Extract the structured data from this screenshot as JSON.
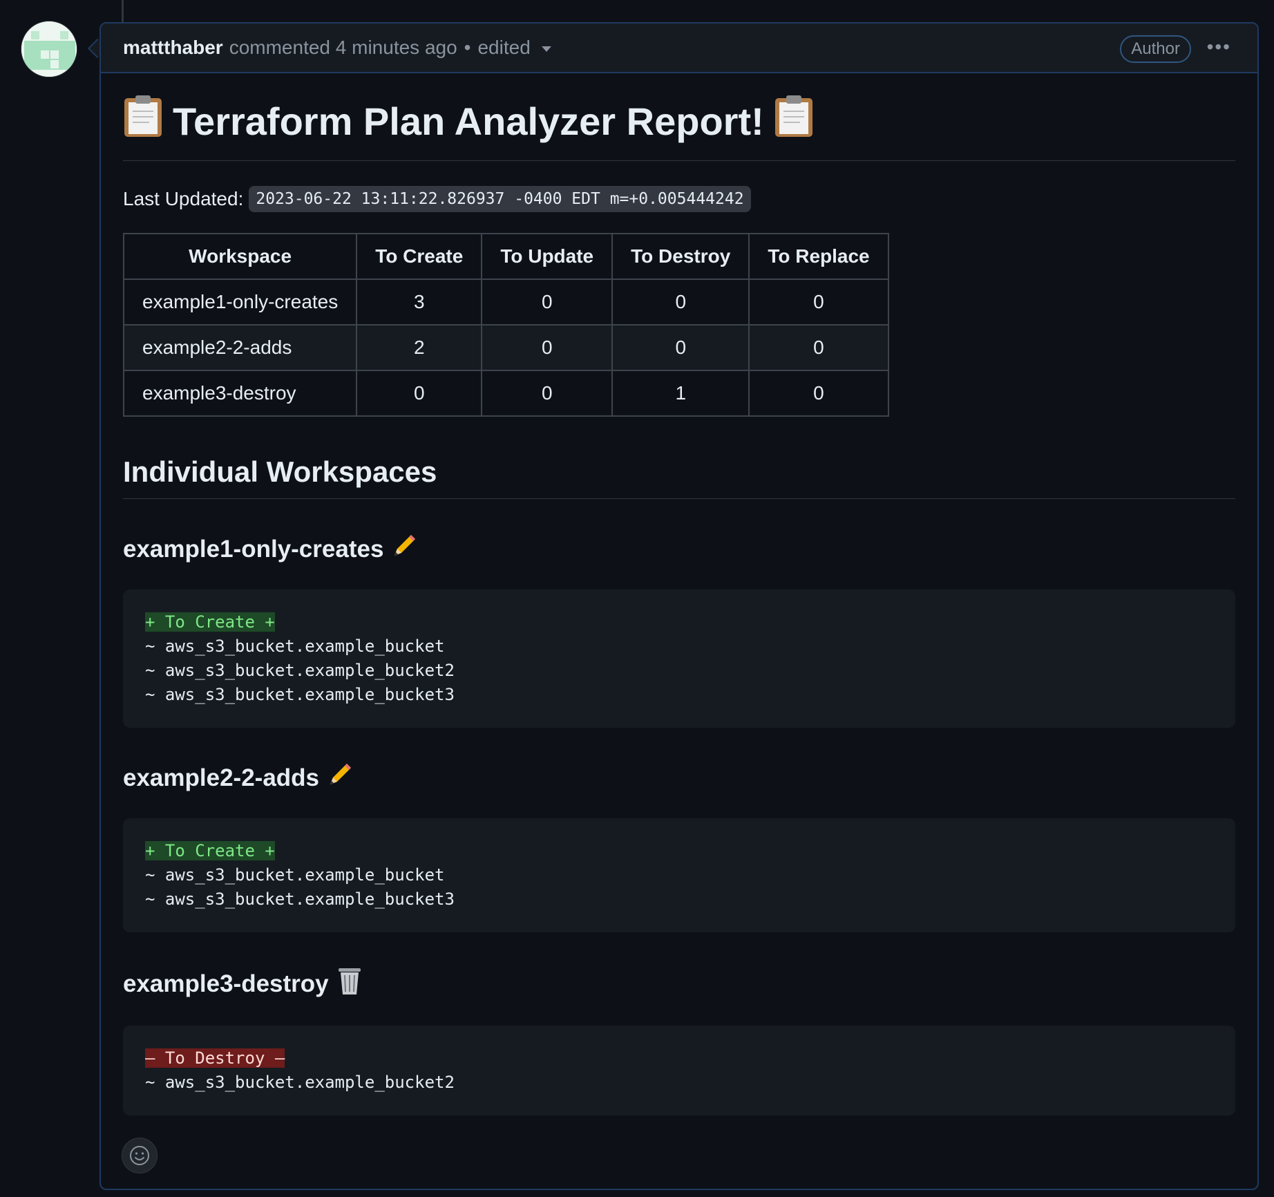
{
  "comment": {
    "author": "mattthaber",
    "action": "commented",
    "time": "4 minutes ago",
    "separator": "•",
    "edited": "edited",
    "badge": "Author",
    "menu": "•••"
  },
  "report": {
    "title": "Terraform Plan Analyzer Report!",
    "title_icon": "clipboard-icon",
    "updated_label": "Last Updated:",
    "updated_value": "2023-06-22 13:11:22.826937 -0400 EDT m=+0.005444242",
    "table": {
      "headers": [
        "Workspace",
        "To Create",
        "To Update",
        "To Destroy",
        "To Replace"
      ],
      "rows": [
        [
          "example1-only-creates",
          "3",
          "0",
          "0",
          "0"
        ],
        [
          "example2-2-adds",
          "2",
          "0",
          "0",
          "0"
        ],
        [
          "example3-destroy",
          "0",
          "0",
          "1",
          "0"
        ]
      ]
    },
    "section_title": "Individual Workspaces",
    "workspaces": [
      {
        "name": "example1-only-creates",
        "icon": "pencil-icon",
        "tag": "+ To Create +",
        "lines": [
          "~ aws_s3_bucket.example_bucket",
          "~ aws_s3_bucket.example_bucket2",
          "~ aws_s3_bucket.example_bucket3"
        ]
      },
      {
        "name": "example2-2-adds",
        "icon": "pencil-icon",
        "tag": "+ To Create +",
        "lines": [
          "~ aws_s3_bucket.example_bucket",
          "~ aws_s3_bucket.example_bucket3"
        ]
      },
      {
        "name": "example3-destroy",
        "icon": "wastebasket-icon",
        "tag": "– To Destroy –",
        "lines": [
          "~ aws_s3_bucket.example_bucket2"
        ]
      }
    ]
  },
  "colors": {
    "background": "#0d1117",
    "header_bg": "#161b22",
    "create_tag_bg": "#1e4a27",
    "create_tag_fg": "#7ee787",
    "destroy_tag_bg": "#6e1c1c",
    "border_accent": "#1f3a5f"
  }
}
